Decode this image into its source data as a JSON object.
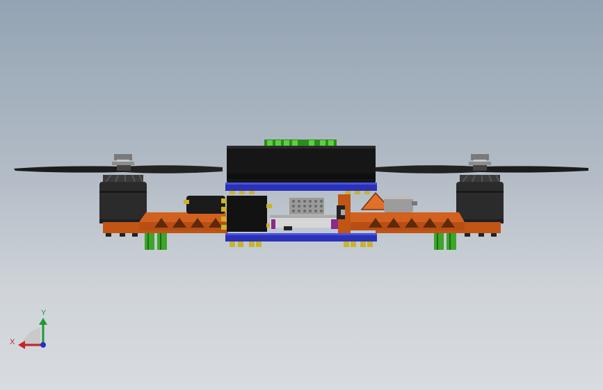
{
  "triad": {
    "x_label": "X",
    "y_label": "Y",
    "x_color": "#c8202a",
    "y_color": "#1e9a2e",
    "z_color": "#2230c8"
  },
  "palette": {
    "frame_orange": "#d2601e",
    "frame_dark": "#8a3a0e",
    "battery_black": "#161616",
    "plate_blue": "#2a32b8",
    "motor_dark": "#2a2a2a",
    "prop_dark": "#1c1c1c",
    "standoff_green": "#3ca52a",
    "nut_yellow": "#c9b42a",
    "board_purple": "#8a2a8c",
    "camera_grey": "#9a9a9a"
  },
  "model": {
    "name": "quadcopter-front-view"
  }
}
